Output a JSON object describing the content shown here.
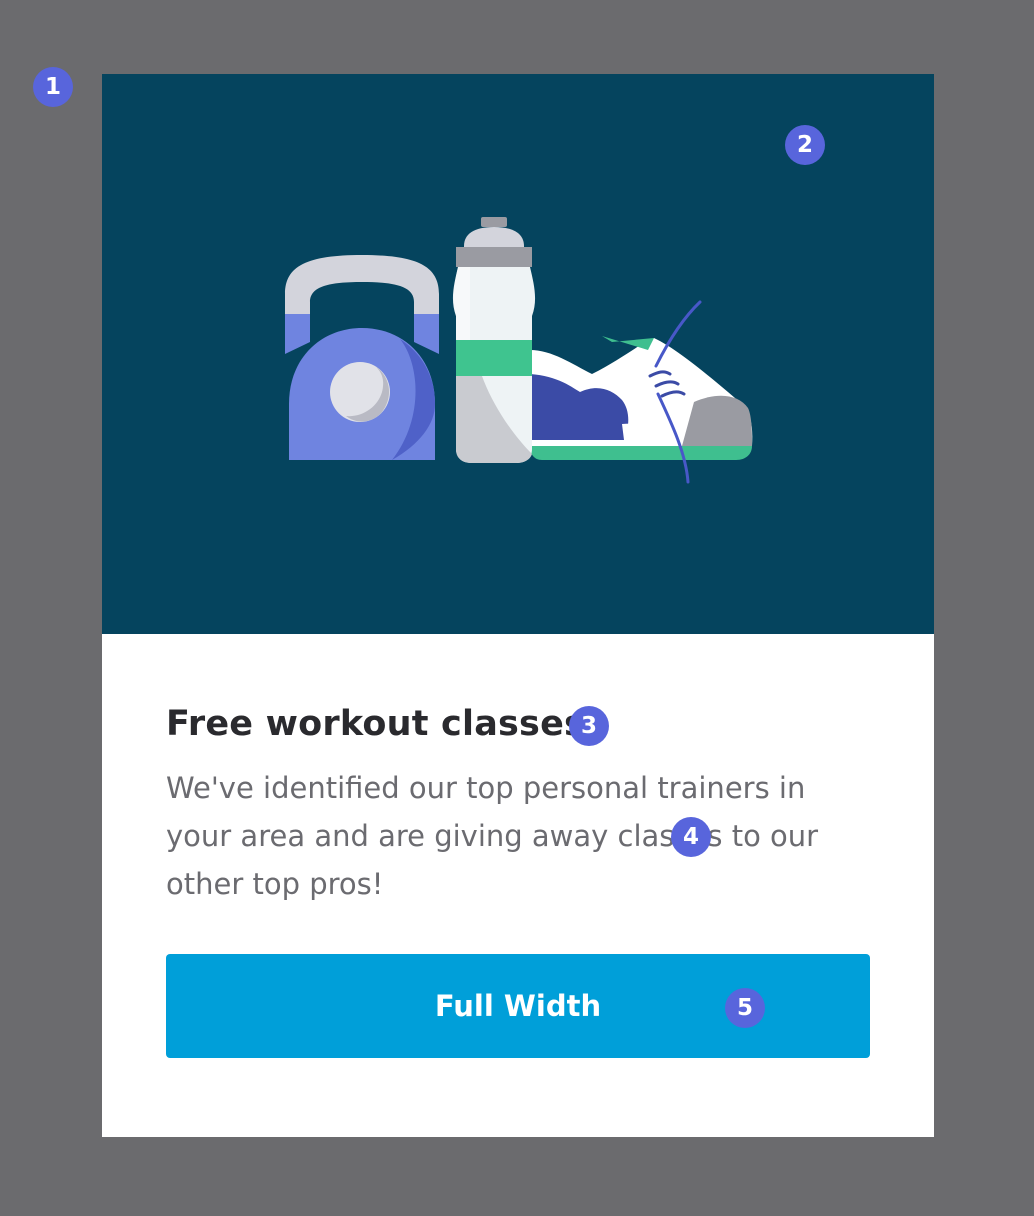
{
  "card": {
    "title": "Free workout classes",
    "description": "We've identified our top personal trainers in your area and are giving away classes to our other top pros!",
    "button_label": "Full Width"
  },
  "markers": [
    "1",
    "2",
    "3",
    "4",
    "5"
  ],
  "colors": {
    "page_background": "#6b6b6e",
    "hero_background": "#05445e",
    "button_background": "#009fd9",
    "marker": "#5865dc"
  },
  "illustration_icons": [
    "kettlebell-icon",
    "water-bottle-icon",
    "sneaker-icon"
  ]
}
